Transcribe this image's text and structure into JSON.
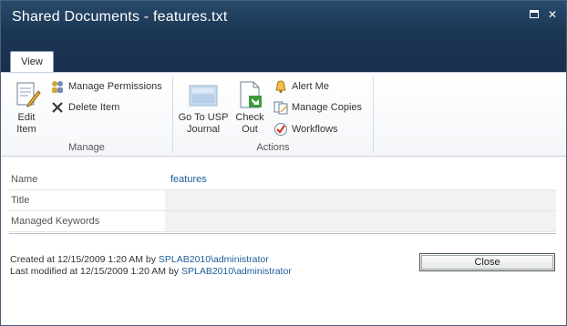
{
  "window": {
    "title": "Shared Documents - features.txt"
  },
  "ribbon": {
    "tab": "View",
    "manage": {
      "label": "Manage",
      "edit_item": [
        "Edit",
        "Item"
      ],
      "manage_permissions": "Manage Permissions",
      "delete_item": "Delete Item"
    },
    "actions": {
      "label": "Actions",
      "go_to_usp_journal": [
        "Go To USP",
        "Journal"
      ],
      "check_out": [
        "Check",
        "Out"
      ],
      "alert_me": "Alert Me",
      "manage_copies": "Manage Copies",
      "workflows": "Workflows"
    }
  },
  "properties": [
    {
      "label": "Name",
      "value": "features"
    },
    {
      "label": "Title",
      "value": ""
    },
    {
      "label": "Managed Keywords",
      "value": ""
    }
  ],
  "footer": {
    "created_prefix": "Created at 12/15/2009 1:20 AM  by ",
    "created_by": "SPLAB2010\\administrator",
    "modified_prefix": "Last modified at 12/15/2009 1:20 AM  by ",
    "modified_by": "SPLAB2010\\administrator"
  },
  "close_button": "Close",
  "colors": {
    "title_bar": "#1b3654",
    "link": "#1c5d99"
  }
}
